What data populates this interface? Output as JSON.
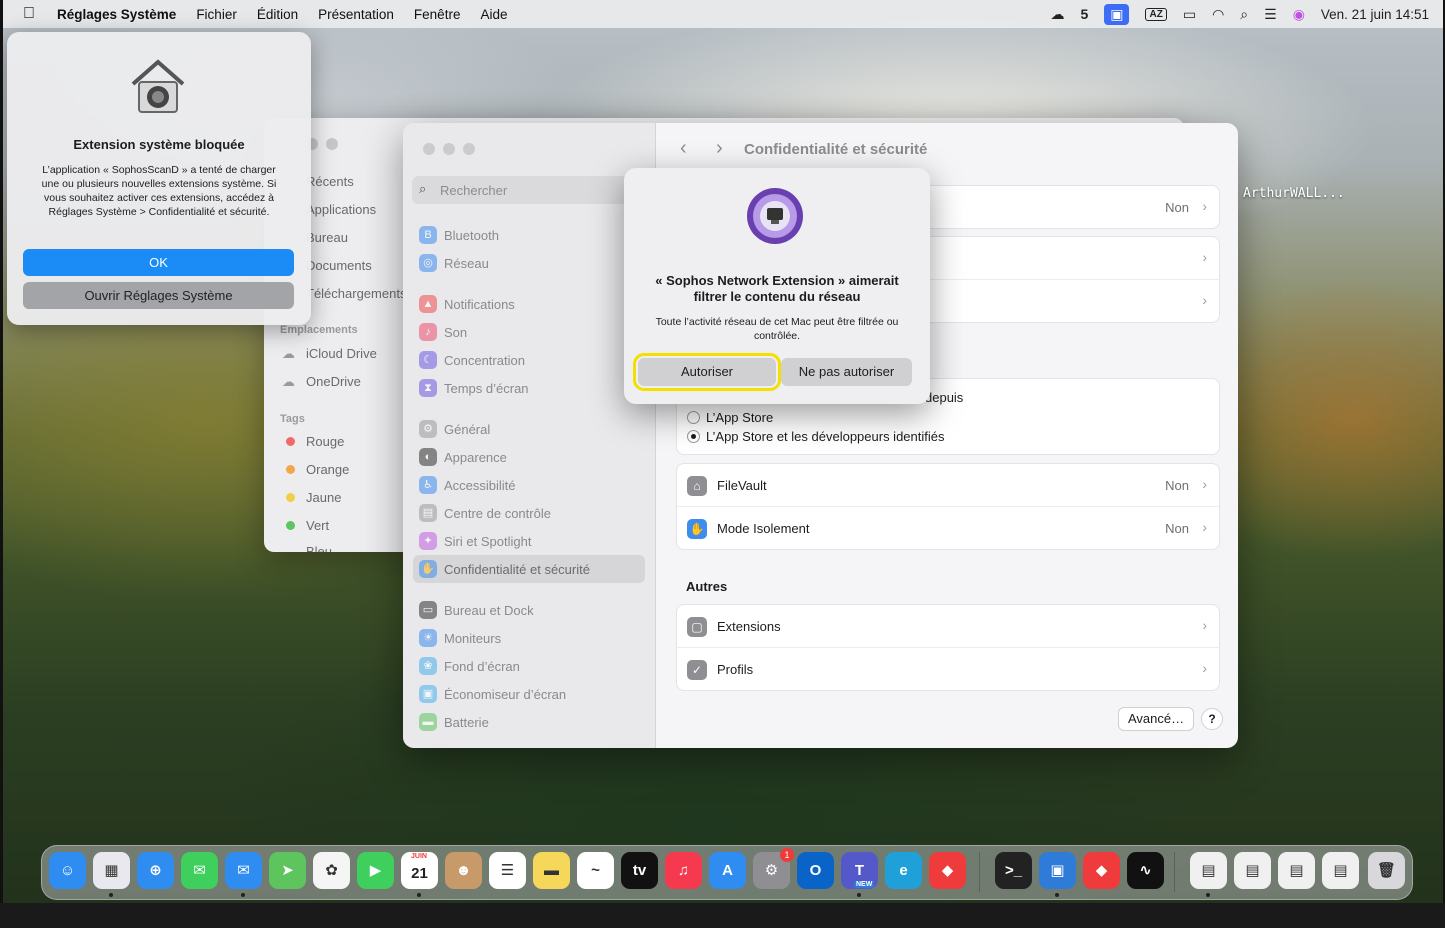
{
  "menubar": {
    "apple_icon": "apple-icon",
    "app_name": "Réglages Système",
    "menus": [
      "Fichier",
      "Édition",
      "Présentation",
      "Fenêtre",
      "Aide"
    ],
    "status_icons": [
      "cloud-icon",
      "s5-icon",
      "screen-share-icon",
      "AZ",
      "battery-icon",
      "wifi-icon",
      "search-icon",
      "control-center-icon",
      "siri-icon"
    ],
    "input_source": "AZ",
    "clock": "Ven. 21 juin  14:51"
  },
  "notification": {
    "title": "Extension système bloquée",
    "body": "L’application « SophosScanD » a tenté de charger une ou plusieurs nouvelles extensions système. Si vous souhaitez activer ces extensions, accédez à Réglages Système > Confidentialité et sécurité.",
    "ok_label": "OK",
    "open_label": "Ouvrir Réglages Système"
  },
  "finder": {
    "items": [
      "Récents",
      "Applications",
      "Bureau",
      "Documents",
      "Téléchargements"
    ],
    "locations_header": "Emplacements",
    "locations": [
      "iCloud Drive",
      "OneDrive"
    ],
    "tags_header": "Tags",
    "tags": [
      {
        "label": "Rouge",
        "color": "#f06a6a"
      },
      {
        "label": "Orange",
        "color": "#f3a64a"
      },
      {
        "label": "Jaune",
        "color": "#f0cf47"
      },
      {
        "label": "Vert",
        "color": "#5ec45e"
      },
      {
        "label": "Bleu",
        "color": "#4a9af0"
      }
    ]
  },
  "settings": {
    "search_placeholder": "Rechercher",
    "sidebar": [
      {
        "label": "Bluetooth",
        "color": "#3d8cf0",
        "icon": "B"
      },
      {
        "label": "Réseau",
        "color": "#3d8cf0",
        "icon": "◎"
      },
      {
        "label": "Notifications",
        "color": "#f05050",
        "icon": "▲"
      },
      {
        "label": "Son",
        "color": "#f05070",
        "icon": "♪"
      },
      {
        "label": "Concentration",
        "color": "#6e5ae0",
        "icon": "☾"
      },
      {
        "label": "Temps d’écran",
        "color": "#6e5ae0",
        "icon": "⧗"
      },
      {
        "label": "Général",
        "color": "#9a9a9e",
        "icon": "⚙"
      },
      {
        "label": "Apparence",
        "color": "#333",
        "icon": "◐"
      },
      {
        "label": "Accessibilité",
        "color": "#3d8cf0",
        "icon": "♿"
      },
      {
        "label": "Centre de contrôle",
        "color": "#9a9a9e",
        "icon": "▤"
      },
      {
        "label": "Siri et Spotlight",
        "color": "#c060e0",
        "icon": "✦"
      },
      {
        "label": "Confidentialité et sécurité",
        "color": "#3d8cf0",
        "icon": "✋"
      },
      {
        "label": "Bureau et Dock",
        "color": "#333",
        "icon": "▭"
      },
      {
        "label": "Moniteurs",
        "color": "#3d8cf0",
        "icon": "☀"
      },
      {
        "label": "Fond d’écran",
        "color": "#4ab0f0",
        "icon": "❀"
      },
      {
        "label": "Économiseur d’écran",
        "color": "#4ab0f0",
        "icon": "▣"
      },
      {
        "label": "Batterie",
        "color": "#5ec45e",
        "icon": "▬"
      }
    ],
    "page_title": "Confidentialité et sécurité",
    "top_rows": [
      {
        "value": "Non"
      },
      {
        "value": ""
      },
      {
        "value": ""
      }
    ],
    "allow_from_partial": "depuis",
    "radio_options": [
      "L’App Store",
      "L’App Store et les développeurs identifiés"
    ],
    "security_rows": [
      {
        "label": "FileVault",
        "value": "Non",
        "color": "#8e8e93",
        "icon": "⌂"
      },
      {
        "label": "Mode Isolement",
        "value": "Non",
        "color": "#3d8cf0",
        "icon": "✋"
      }
    ],
    "others_title": "Autres",
    "others_rows": [
      {
        "label": "Extensions",
        "color": "#8e8e93",
        "icon": "▢"
      },
      {
        "label": "Profils",
        "color": "#8e8e93",
        "icon": "✓"
      }
    ],
    "advanced_label": "Avancé…",
    "help_label": "?"
  },
  "alert": {
    "title": "« Sophos Network Extension » aimerait filtrer le contenu du réseau",
    "body": "Toute l’activité réseau de cet Mac peut être filtrée ou contrôlée.",
    "allow_label": "Autoriser",
    "deny_label": "Ne pas autoriser"
  },
  "desktop": {
    "label": "ArthurWALL..."
  },
  "dock": {
    "apps": [
      {
        "name": "finder-icon",
        "color": "#2f8cf0",
        "glyph": "☺"
      },
      {
        "name": "launchpad-icon",
        "color": "#e8e8ee",
        "glyph": "▦"
      },
      {
        "name": "safari-icon",
        "color": "#2f8cf0",
        "glyph": "⊕"
      },
      {
        "name": "messages-icon",
        "color": "#3ecf5c",
        "glyph": "✉"
      },
      {
        "name": "mail-icon",
        "color": "#2f8cf0",
        "glyph": "✉"
      },
      {
        "name": "maps-icon",
        "color": "#5ec45e",
        "glyph": "➤"
      },
      {
        "name": "photos-icon",
        "color": "#f5f5f5",
        "glyph": "✿"
      },
      {
        "name": "facetime-icon",
        "color": "#3ecf5c",
        "glyph": "▶"
      },
      {
        "name": "calendar-icon",
        "color": "#ffffff",
        "glyph": "21"
      },
      {
        "name": "contacts-icon",
        "color": "#c89a6a",
        "glyph": "☻"
      },
      {
        "name": "reminders-icon",
        "color": "#ffffff",
        "glyph": "☰"
      },
      {
        "name": "notes-icon",
        "color": "#f5d75a",
        "glyph": "▬"
      },
      {
        "name": "freeform-icon",
        "color": "#ffffff",
        "glyph": "~"
      },
      {
        "name": "appletv-icon",
        "color": "#111111",
        "glyph": "tv"
      },
      {
        "name": "music-icon",
        "color": "#f5394e",
        "glyph": "♫"
      },
      {
        "name": "appstore-icon",
        "color": "#2f8cf0",
        "glyph": "A"
      },
      {
        "name": "system-settings-icon",
        "color": "#8e8e93",
        "glyph": "⚙"
      },
      {
        "name": "outlook-icon",
        "color": "#0a64c8",
        "glyph": "O"
      },
      {
        "name": "teams-icon",
        "color": "#5558c8",
        "glyph": "T"
      },
      {
        "name": "edge-icon",
        "color": "#1fa0d8",
        "glyph": "e"
      },
      {
        "name": "anydesk-icon",
        "color": "#ef3b3b",
        "glyph": "◆"
      },
      {
        "name": "terminal-icon",
        "color": "#222222",
        "glyph": ">_"
      },
      {
        "name": "remote-desktop-icon",
        "color": "#2f7cd8",
        "glyph": "▣"
      },
      {
        "name": "anydesk-alt-icon",
        "color": "#ef3b3b",
        "glyph": "◆"
      },
      {
        "name": "activity-monitor-icon",
        "color": "#111111",
        "glyph": "∿"
      },
      {
        "name": "document-1-icon",
        "color": "#f0f0f0",
        "glyph": "▤"
      },
      {
        "name": "document-2-icon",
        "color": "#f0f0f0",
        "glyph": "▤"
      },
      {
        "name": "document-3-icon",
        "color": "#f0f0f0",
        "glyph": "▤"
      },
      {
        "name": "document-4-icon",
        "color": "#f0f0f0",
        "glyph": "▤"
      },
      {
        "name": "trash-icon",
        "color": "#d8d8dc",
        "glyph": "🗑"
      }
    ],
    "calendar_month": "JUIN",
    "settings_badge": "1",
    "teams_badge": "NEW"
  }
}
